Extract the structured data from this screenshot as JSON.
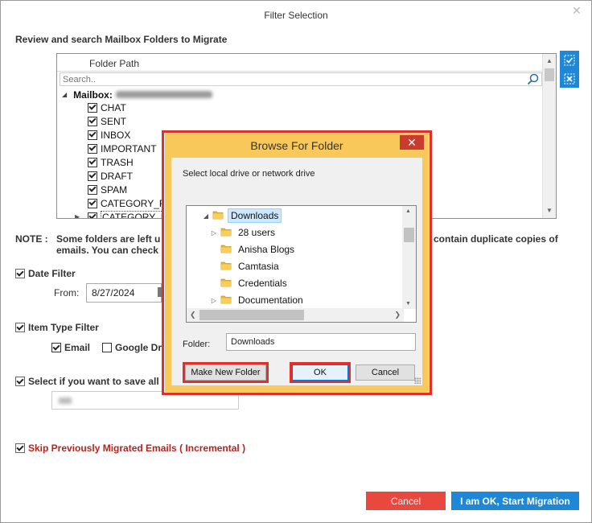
{
  "window": {
    "title": "Filter Selection"
  },
  "heading": "Review and search Mailbox Folders to Migrate",
  "folder_tree": {
    "column_header": "Folder Path",
    "search_placeholder": "Search..",
    "mailbox_label": "Mailbox:",
    "folders": [
      {
        "name": "CHAT",
        "checked": true
      },
      {
        "name": "SENT",
        "checked": true
      },
      {
        "name": "INBOX",
        "checked": true
      },
      {
        "name": "IMPORTANT",
        "checked": true
      },
      {
        "name": "TRASH",
        "checked": true
      },
      {
        "name": "DRAFT",
        "checked": true
      },
      {
        "name": "SPAM",
        "checked": true
      },
      {
        "name": "CATEGORY_FO",
        "checked": true
      },
      {
        "name": "CATEGORY_U",
        "checked": true
      }
    ]
  },
  "note": {
    "label": "NOTE :",
    "text_line1": "Some folders are left unch",
    "text_line2": "emails. You can check and",
    "tail": "contain duplicate copies of"
  },
  "date_filter": {
    "label": "Date Filter",
    "checked": true,
    "from_label": "From:",
    "from_value": "8/27/2024"
  },
  "item_type_filter": {
    "label": "Item Type Filter",
    "checked": true,
    "email_label": "Email",
    "email_checked": true,
    "gdrive_label": "Google Driv",
    "gdrive_checked": false
  },
  "save_all": {
    "label": "Select if you want to save all dat",
    "checked": true
  },
  "skip": {
    "label": "Skip Previously Migrated Emails ( Incremental )",
    "checked": true
  },
  "buttons": {
    "cancel": "Cancel",
    "start": "I am OK, Start Migration"
  },
  "browse_dialog": {
    "title": "Browse For Folder",
    "close_glyph": "✕",
    "instruction": "Select local drive or network drive",
    "tree": [
      {
        "label": "Downloads",
        "expanded": true,
        "selected": true
      },
      {
        "label": "28 users",
        "expandable": true
      },
      {
        "label": "Anisha Blogs"
      },
      {
        "label": "Camtasia"
      },
      {
        "label": "Credentials"
      },
      {
        "label": "Documentation",
        "expandable": true
      }
    ],
    "folder_label": "Folder:",
    "folder_value": "Downloads",
    "make_new_folder": "Make New Folder",
    "ok": "OK",
    "cancel": "Cancel"
  },
  "colors": {
    "accent_blue": "#1e88d6",
    "cancel_red": "#e8483d",
    "highlight_red": "#e0302c",
    "dialog_frame": "#f9c85a",
    "skip_text": "#b6231c"
  }
}
